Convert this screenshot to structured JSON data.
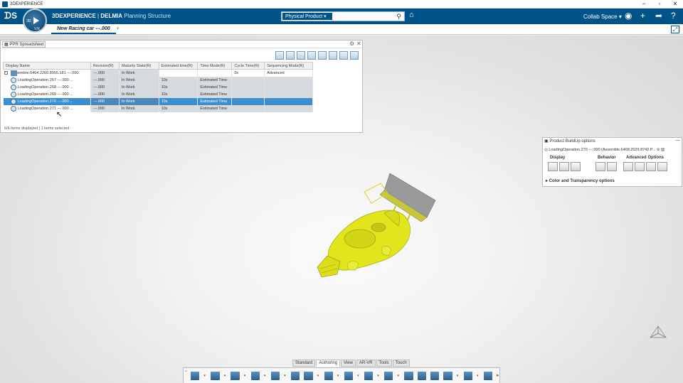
{
  "window": {
    "title": "3DEXPERIENCE"
  },
  "header": {
    "brand_platform": "3DEXPERIENCE",
    "brand_sep": " | ",
    "brand_company": "DELMIA",
    "brand_app": "Planning Structure",
    "search_scope": "Physical Product",
    "search_placeholder": "",
    "collab_space": "Collab Space"
  },
  "compass": {
    "top": "3D",
    "left": "V.R",
    "right": "",
    "bottom": ""
  },
  "tabs": [
    {
      "label": "New Racing car ---.000"
    }
  ],
  "ppr": {
    "title": "PPR Spreadsheet",
    "columns": [
      "Display Name",
      "Revision(R)",
      "Maturity State(R)",
      "Estimated time(R)",
      "Time Mode(R)",
      "Cycle Time(R)",
      "Sequencing Mode(R)"
    ],
    "rows": [
      {
        "name": "Assemble.6464.2260.8955.181 ---.000",
        "revision": "---.000",
        "maturity": "In Work",
        "est": "",
        "mode": "",
        "cycle": "0s",
        "seq": "Advanced"
      },
      {
        "name": "LoadingOperation.267 ---.000 ...",
        "revision": "---.000",
        "maturity": "In Work",
        "est": "10s",
        "mode": "Estimated Time",
        "cycle": "",
        "seq": ""
      },
      {
        "name": "LoadingOperation.268 ---.000 ...",
        "revision": "---.000",
        "maturity": "In Work",
        "est": "10s",
        "mode": "Estimated Time",
        "cycle": "",
        "seq": ""
      },
      {
        "name": "LoadingOperation.269 ---.000 ...",
        "revision": "---.000",
        "maturity": "In Work",
        "est": "10s",
        "mode": "Estimated Time",
        "cycle": "",
        "seq": ""
      },
      {
        "name": "LoadingOperation.270 ---.000 ...",
        "revision": "---.000",
        "maturity": "In Work",
        "est": "10s",
        "mode": "Estimated Time",
        "cycle": "",
        "seq": ""
      },
      {
        "name": "LoadingOperation.271 ---.000 ...",
        "revision": "---.000",
        "maturity": "In Work",
        "est": "10s",
        "mode": "Estimated Time",
        "cycle": "",
        "seq": ""
      }
    ],
    "status": "6/6 items displayed | 1 items selected"
  },
  "pbu": {
    "title": "Product BuildUp options",
    "operation": "LoadingOperation.270 ---.000 (Assemble.6468.2029.8742.P...",
    "group_display": "Display",
    "group_behavior": "Behavior",
    "group_advanced": "Advanced Options",
    "color_section": "Color and Transparency options"
  },
  "actionbar": {
    "tabs": [
      "Standard",
      "Authoring",
      "View",
      "AR-VR",
      "Tools",
      "Touch"
    ],
    "active_tab": "Authoring"
  },
  "colors": {
    "brand": "#005386",
    "selection": "#3c8ecf",
    "car_yellow": "#e3e51c"
  }
}
